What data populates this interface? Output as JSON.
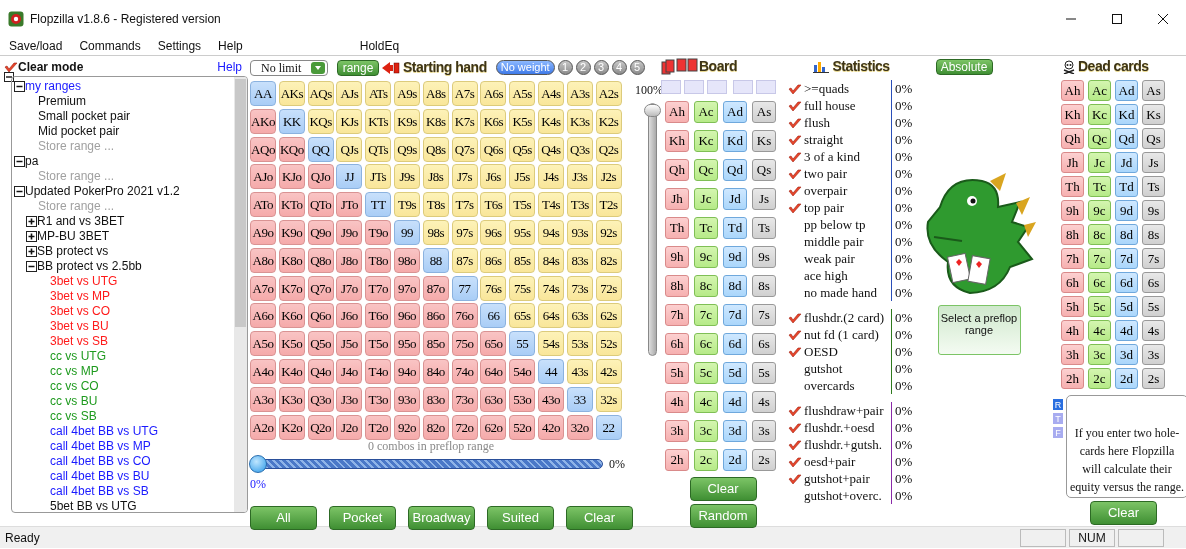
{
  "window": {
    "title": "Flopzilla v1.8.6 - Registered version"
  },
  "menu": [
    "Save/load",
    "Commands",
    "Settings",
    "Help",
    "HoldEq"
  ],
  "left_panel": {
    "clear_mode": "Clear mode",
    "help": "Help",
    "root_expanded": true,
    "tree": [
      {
        "label": "my ranges",
        "expanded": true,
        "color": "#1a1aff",
        "children": [
          {
            "label": "Premium",
            "color": "#111111"
          },
          {
            "label": "Small pocket pair",
            "color": "#111111"
          },
          {
            "label": "Mid pocket pair",
            "color": "#111111"
          },
          {
            "label": "Store range ...",
            "color": "#a0a0a0"
          }
        ]
      },
      {
        "label": "pa",
        "expanded": true,
        "color": "#111111",
        "children": [
          {
            "label": "Store range ...",
            "color": "#a0a0a0"
          }
        ]
      },
      {
        "label": "Updated PokerPro 2021 v1.2",
        "expanded": true,
        "color": "#111111",
        "children": [
          {
            "label": "Store range ...",
            "color": "#a0a0a0"
          },
          {
            "label": "R1 and vs 3BET",
            "expanded": false,
            "color": "#111111"
          },
          {
            "label": "MP-BU 3BET",
            "expanded": false,
            "color": "#111111"
          },
          {
            "label": "SB protect vs",
            "expanded": false,
            "color": "#111111"
          },
          {
            "label": "BB protect vs 2.5bb",
            "expanded": true,
            "color": "#111111",
            "children": [
              {
                "label": "3bet vs UTG",
                "color": "#ff1a1a"
              },
              {
                "label": "3bet vs MP",
                "color": "#ff1a1a"
              },
              {
                "label": "3bet vs CO",
                "color": "#ff1a1a"
              },
              {
                "label": "3bet vs BU",
                "color": "#ff1a1a"
              },
              {
                "label": "3bet vs SB",
                "color": "#ff1a1a"
              },
              {
                "label": "cc vs UTG",
                "color": "#1e9a1e"
              },
              {
                "label": "cc vs MP",
                "color": "#1e9a1e"
              },
              {
                "label": "cc vs CO",
                "color": "#1e9a1e"
              },
              {
                "label": "cc vs BU",
                "color": "#1e9a1e"
              },
              {
                "label": "cc vs SB",
                "color": "#1e9a1e"
              },
              {
                "label": "call 4bet BB vs UTG",
                "color": "#1a1aff"
              },
              {
                "label": "call 4bet BB vs MP",
                "color": "#1a1aff"
              },
              {
                "label": "call 4bet BB vs CO",
                "color": "#1a1aff"
              },
              {
                "label": "call 4bet BB vs BU",
                "color": "#1a1aff"
              },
              {
                "label": "call 4bet BB vs SB",
                "color": "#1a1aff"
              },
              {
                "label": "5bet BB vs UTG",
                "color": "#111111"
              }
            ]
          }
        ]
      }
    ]
  },
  "range_panel": {
    "game_select": "No limit",
    "range_button": "range",
    "title": "Starting hand",
    "weights": [
      {
        "label": "No weight",
        "selected": true
      },
      {
        "label": "1",
        "selected": false
      },
      {
        "label": "2",
        "selected": false
      },
      {
        "label": "3",
        "selected": false
      },
      {
        "label": "4",
        "selected": false
      },
      {
        "label": "5",
        "selected": false
      }
    ],
    "hands": [
      [
        "AA",
        "AKs",
        "AQs",
        "AJs",
        "ATs",
        "A9s",
        "A8s",
        "A7s",
        "A6s",
        "A5s",
        "A4s",
        "A3s",
        "A2s"
      ],
      [
        "AKo",
        "KK",
        "KQs",
        "KJs",
        "KTs",
        "K9s",
        "K8s",
        "K7s",
        "K6s",
        "K5s",
        "K4s",
        "K3s",
        "K2s"
      ],
      [
        "AQo",
        "KQo",
        "QQ",
        "QJs",
        "QTs",
        "Q9s",
        "Q8s",
        "Q7s",
        "Q6s",
        "Q5s",
        "Q4s",
        "Q3s",
        "Q2s"
      ],
      [
        "AJo",
        "KJo",
        "QJo",
        "JJ",
        "JTs",
        "J9s",
        "J8s",
        "J7s",
        "J6s",
        "J5s",
        "J4s",
        "J3s",
        "J2s"
      ],
      [
        "ATo",
        "KTo",
        "QTo",
        "JTo",
        "TT",
        "T9s",
        "T8s",
        "T7s",
        "T6s",
        "T5s",
        "T4s",
        "T3s",
        "T2s"
      ],
      [
        "A9o",
        "K9o",
        "Q9o",
        "J9o",
        "T9o",
        "99",
        "98s",
        "97s",
        "96s",
        "95s",
        "94s",
        "93s",
        "92s"
      ],
      [
        "A8o",
        "K8o",
        "Q8o",
        "J8o",
        "T8o",
        "98o",
        "88",
        "87s",
        "86s",
        "85s",
        "84s",
        "83s",
        "82s"
      ],
      [
        "A7o",
        "K7o",
        "Q7o",
        "J7o",
        "T7o",
        "97o",
        "87o",
        "77",
        "76s",
        "75s",
        "74s",
        "73s",
        "72s"
      ],
      [
        "A6o",
        "K6o",
        "Q6o",
        "J6o",
        "T6o",
        "96o",
        "86o",
        "76o",
        "66",
        "65s",
        "64s",
        "63s",
        "62s"
      ],
      [
        "A5o",
        "K5o",
        "Q5o",
        "J5o",
        "T5o",
        "95o",
        "85o",
        "75o",
        "65o",
        "55",
        "54s",
        "53s",
        "52s"
      ],
      [
        "A4o",
        "K4o",
        "Q4o",
        "J4o",
        "T4o",
        "94o",
        "84o",
        "74o",
        "64o",
        "54o",
        "44",
        "43s",
        "42s"
      ],
      [
        "A3o",
        "K3o",
        "Q3o",
        "J3o",
        "T3o",
        "93o",
        "83o",
        "73o",
        "63o",
        "53o",
        "43o",
        "33",
        "32s"
      ],
      [
        "A2o",
        "K2o",
        "Q2o",
        "J2o",
        "T2o",
        "92o",
        "82o",
        "72o",
        "62o",
        "52o",
        "42o",
        "32o",
        "22"
      ]
    ],
    "weight_slider": {
      "label": "100%",
      "level": 1
    },
    "combos": "0 combos in preflop range",
    "range_slider": {
      "level": 0,
      "reading": "0%",
      "below": "0%"
    },
    "buttons": [
      "All",
      "Pocket",
      "Broadway",
      "Suited",
      "Clear"
    ]
  },
  "board": {
    "title": "Board",
    "cards": [
      [
        "Ah",
        "Ac",
        "Ad",
        "As"
      ],
      [
        "Kh",
        "Kc",
        "Kd",
        "Ks"
      ],
      [
        "Qh",
        "Qc",
        "Qd",
        "Qs"
      ],
      [
        "Jh",
        "Jc",
        "Jd",
        "Js"
      ],
      [
        "Th",
        "Tc",
        "Td",
        "Ts"
      ],
      [
        "9h",
        "9c",
        "9d",
        "9s"
      ],
      [
        "8h",
        "8c",
        "8d",
        "8s"
      ],
      [
        "7h",
        "7c",
        "7d",
        "7s"
      ],
      [
        "6h",
        "6c",
        "6d",
        "6s"
      ],
      [
        "5h",
        "5c",
        "5d",
        "5s"
      ],
      [
        "4h",
        "4c",
        "4d",
        "4s"
      ],
      [
        "3h",
        "3c",
        "3d",
        "3s"
      ],
      [
        "2h",
        "2c",
        "2d",
        "2s"
      ]
    ],
    "buttons": [
      "Clear",
      "Random"
    ]
  },
  "statistics": {
    "title": "Statistics",
    "mode_button": "Absolute",
    "groups": [
      {
        "color": "#2a4fb8",
        "items": [
          {
            "label": ">=quads",
            "value": "0%",
            "checked": true
          },
          {
            "label": "full house",
            "value": "0%",
            "checked": true
          },
          {
            "label": "flush",
            "value": "0%",
            "checked": true
          },
          {
            "label": "straight",
            "value": "0%",
            "checked": true
          },
          {
            "label": "3 of a kind",
            "value": "0%",
            "checked": true
          },
          {
            "label": "two pair",
            "value": "0%",
            "checked": true
          },
          {
            "label": "overpair",
            "value": "0%",
            "checked": true
          },
          {
            "label": "top pair",
            "value": "0%",
            "checked": true
          },
          {
            "label": "pp below tp",
            "value": "0%",
            "checked": false
          },
          {
            "label": "middle pair",
            "value": "0%",
            "checked": false
          },
          {
            "label": "weak pair",
            "value": "0%",
            "checked": false
          },
          {
            "label": "ace high",
            "value": "0%",
            "checked": false
          },
          {
            "label": "no made hand",
            "value": "0%",
            "checked": false
          }
        ]
      },
      {
        "color": "#2f7a1e",
        "items": [
          {
            "label": "flushdr.(2 card)",
            "value": "0%",
            "checked": true
          },
          {
            "label": "nut fd (1 card)",
            "value": "0%",
            "checked": true
          },
          {
            "label": "OESD",
            "value": "0%",
            "checked": true
          },
          {
            "label": "gutshot",
            "value": "0%",
            "checked": false
          },
          {
            "label": "overcards",
            "value": "0%",
            "checked": false
          }
        ]
      },
      {
        "color": "#8a2aa8",
        "items": [
          {
            "label": "flushdraw+pair",
            "value": "0%",
            "checked": true
          },
          {
            "label": "flushdr.+oesd",
            "value": "0%",
            "checked": true
          },
          {
            "label": "flushdr.+gutsh.",
            "value": "0%",
            "checked": true
          },
          {
            "label": "oesd+pair",
            "value": "0%",
            "checked": true
          },
          {
            "label": "gutshot+pair",
            "value": "0%",
            "checked": true
          },
          {
            "label": "gutshot+overc.",
            "value": "0%",
            "checked": false
          }
        ]
      }
    ]
  },
  "range_hint": "Select a preflop range",
  "dead_cards": {
    "title": "Dead cards",
    "cards": [
      [
        "Ah",
        "Ac",
        "Ad",
        "As"
      ],
      [
        "Kh",
        "Kc",
        "Kd",
        "Ks"
      ],
      [
        "Qh",
        "Qc",
        "Qd",
        "Qs"
      ],
      [
        "Jh",
        "Jc",
        "Jd",
        "Js"
      ],
      [
        "Th",
        "Tc",
        "Td",
        "Ts"
      ],
      [
        "9h",
        "9c",
        "9d",
        "9s"
      ],
      [
        "8h",
        "8c",
        "8d",
        "8s"
      ],
      [
        "7h",
        "7c",
        "7d",
        "7s"
      ],
      [
        "6h",
        "6c",
        "6d",
        "6s"
      ],
      [
        "5h",
        "5c",
        "5d",
        "5s"
      ],
      [
        "4h",
        "4c",
        "4d",
        "4s"
      ],
      [
        "3h",
        "3c",
        "3d",
        "3s"
      ],
      [
        "2h",
        "2c",
        "2d",
        "2s"
      ]
    ],
    "streets": [
      {
        "label": "R",
        "selected": true
      },
      {
        "label": "T",
        "selected": false
      },
      {
        "label": "F",
        "selected": false
      }
    ],
    "placeholder": "If you enter two hole-cards here Flopzilla will calculate their equity versus the range.",
    "clear_button": "Clear"
  },
  "status_bar": {
    "text": "Ready",
    "indicator": "NUM"
  }
}
